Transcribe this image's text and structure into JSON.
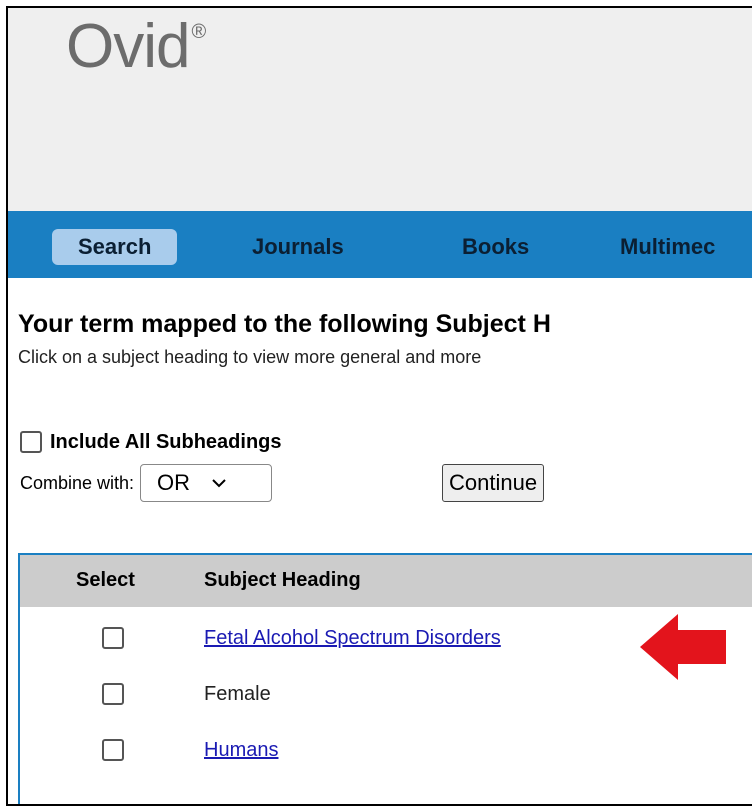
{
  "header": {
    "logo_text": "Ovid",
    "logo_mark": "®"
  },
  "nav": {
    "items": [
      {
        "label": "Search",
        "active": true
      },
      {
        "label": "Journals",
        "active": false
      },
      {
        "label": "Books",
        "active": false
      },
      {
        "label": "Multimec",
        "active": false
      }
    ]
  },
  "page": {
    "title": "Your term mapped to the following Subject H",
    "subtitle": "Click on a subject heading to view more general and more"
  },
  "options": {
    "include_all_subheadings": {
      "label": "Include All Subheadings",
      "checked": false
    },
    "combine_label": "Combine with:",
    "combine_value": "OR",
    "continue_label": "Continue"
  },
  "results": {
    "columns": [
      "Select",
      "Subject Heading"
    ],
    "rows": [
      {
        "term": "Fetal Alcohol Spectrum Disorders",
        "link": true,
        "checked": false
      },
      {
        "term": "Female",
        "link": false,
        "checked": false
      },
      {
        "term": "Humans",
        "link": true,
        "checked": false
      }
    ]
  },
  "colors": {
    "nav_bg": "#1a7fc2",
    "active_tab": "#a9ccec",
    "link": "#1a1ab3",
    "arrow": "#e3141c"
  }
}
